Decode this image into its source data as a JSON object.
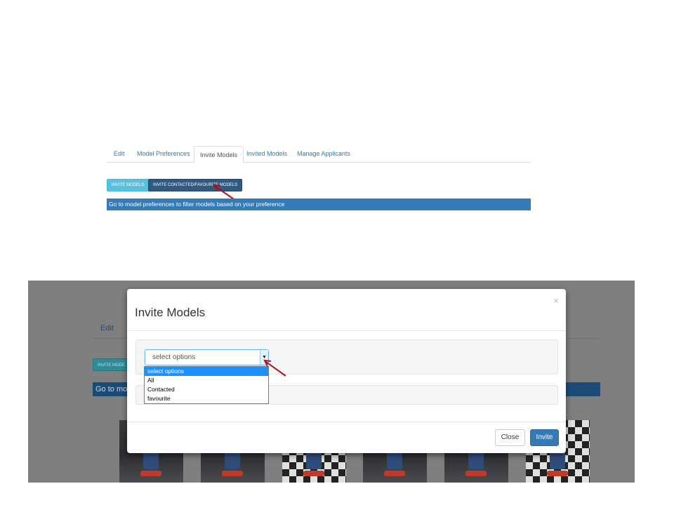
{
  "tabs": [
    "Edit",
    "Model Preferences",
    "Invite Models",
    "Invited Models",
    "Manage Applicants"
  ],
  "active_tab": "Invite Models",
  "buttons": {
    "invite_models": "INVITE MODELS",
    "invite_contacted": "INVITE CONTACTED/FAVOURITE MODELS"
  },
  "info_bar": "Go to model preferences to filter models based on your preference",
  "background": {
    "edit_tab": "Edit",
    "button_fragment": "INVITE MODE",
    "bar_fragment": "Go to mod"
  },
  "modal": {
    "title": "Invite Models",
    "close_x": "×",
    "select_value": "select options",
    "options": [
      "select options",
      "All",
      "Contacted",
      "favourite"
    ],
    "close_button": "Close",
    "invite_button": "Invite"
  },
  "icons": {
    "select_arrow": "caret-down-icon",
    "annotation": "red-arrow-icon"
  },
  "colors": {
    "primary": "#337ab7",
    "info": "#5bc0de",
    "annotation_arrow": "#a8141c"
  }
}
